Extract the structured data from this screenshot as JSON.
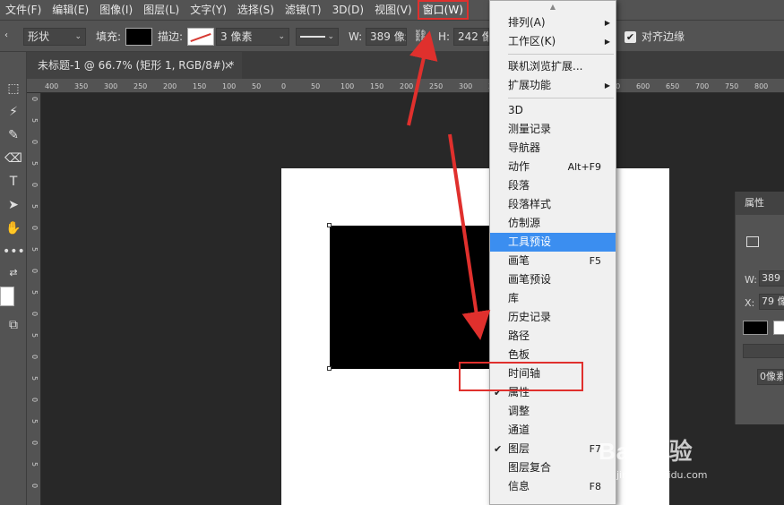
{
  "menubar": {
    "items": [
      "文件(F)",
      "编辑(E)",
      "图像(I)",
      "图层(L)",
      "文字(Y)",
      "选择(S)",
      "滤镜(T)",
      "3D(D)",
      "视图(V)",
      "窗口(W)"
    ]
  },
  "options": {
    "mode": "形状",
    "fill_label": "填充:",
    "stroke_label": "描边:",
    "stroke_width": "3 像素",
    "w_label": "W:",
    "w_value": "389 像素",
    "h_label": "H:",
    "h_value": "242 像素",
    "align_edges_label": "对齐边缘",
    "align_edges_checked": "✔"
  },
  "document": {
    "tab_title": "未标题-1 @ 66.7% (矩形 1, RGB/8#) *",
    "close": "×"
  },
  "rulers": {
    "h": [
      "400",
      "350",
      "300",
      "250",
      "200",
      "150",
      "100",
      "50",
      "0",
      "50",
      "100",
      "150",
      "200",
      "250",
      "300",
      "350",
      "400",
      "450",
      "500",
      "550",
      "600",
      "650",
      "700",
      "750",
      "800",
      "850"
    ],
    "v": [
      "0",
      "5",
      "0",
      "5",
      "0",
      "5",
      "0",
      "5",
      "0",
      "5",
      "0",
      "5",
      "0",
      "5",
      "0",
      "5",
      "0",
      "5",
      "0",
      "5"
    ]
  },
  "props": {
    "tab": "属性",
    "w_label": "W:",
    "w_value": "389",
    "x_label": "X:",
    "x_value": "79 像",
    "px_value": "0像素"
  },
  "window_menu": {
    "items": [
      {
        "label": "排列(A)",
        "submenu": "▶"
      },
      {
        "label": "工作区(K)",
        "submenu": "▶"
      },
      {
        "label": "联机浏览扩展..."
      },
      {
        "label": "扩展功能",
        "submenu": "▶"
      },
      {
        "label": "3D"
      },
      {
        "label": "测量记录"
      },
      {
        "label": "导航器"
      },
      {
        "label": "动作",
        "shortcut": "Alt+F9"
      },
      {
        "label": "段落"
      },
      {
        "label": "段落样式"
      },
      {
        "label": "仿制源"
      },
      {
        "label": "工具预设"
      },
      {
        "label": "画笔",
        "shortcut": "F5"
      },
      {
        "label": "画笔预设"
      },
      {
        "label": "库"
      },
      {
        "label": "历史记录"
      },
      {
        "label": "路径"
      },
      {
        "label": "色板"
      },
      {
        "label": "时间轴"
      },
      {
        "label": "属性",
        "check": "✔"
      },
      {
        "label": "调整"
      },
      {
        "label": "通道"
      },
      {
        "label": "图层",
        "shortcut": "F7",
        "check": "✔"
      },
      {
        "label": "图层复合"
      },
      {
        "label": "信息",
        "shortcut": "F8"
      }
    ]
  },
  "watermark": {
    "brand": "Bai 经验",
    "url": "jingyan.baidu.com"
  },
  "colors": {
    "highlight": "#3b8ef0",
    "annotation": "#e0302d"
  }
}
